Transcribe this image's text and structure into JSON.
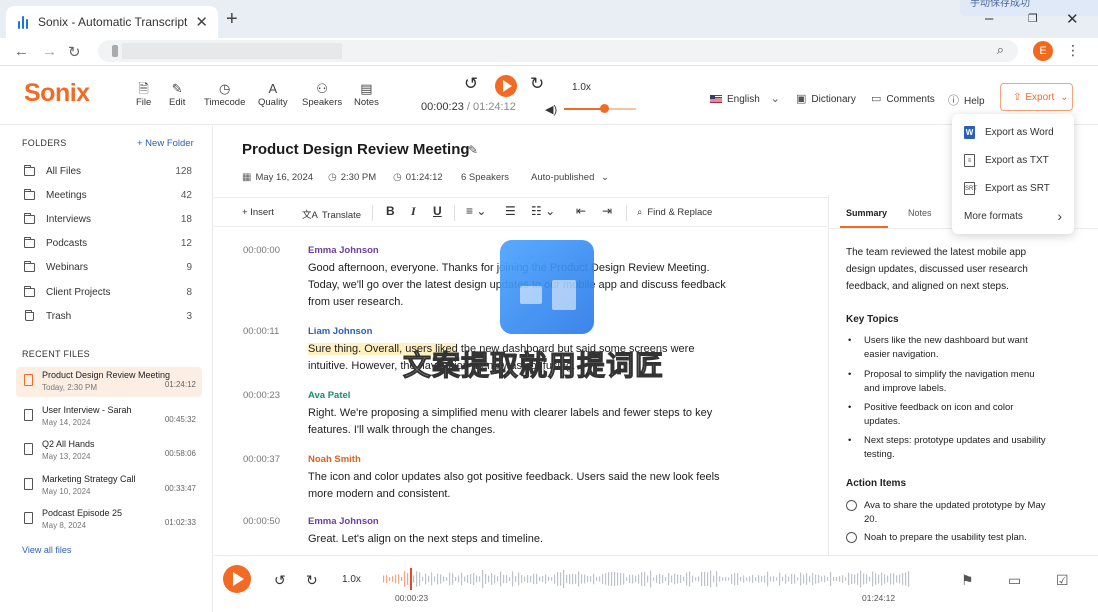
{
  "browser": {
    "tab_title": "Sonix - Automatic Transcription",
    "translate_badge": "手动保存成功",
    "new_tab": "+",
    "close": "✕"
  },
  "header": {
    "logo": "Sonix",
    "tools": [
      {
        "label": "File",
        "icon": "file-icon"
      },
      {
        "label": "Edit",
        "icon": "edit-icon"
      },
      {
        "label": "Timecode",
        "icon": "clock-icon"
      },
      {
        "label": "Quality",
        "icon": "text-quality-icon"
      },
      {
        "label": "Speakers",
        "icon": "speakers-icon"
      },
      {
        "label": "Notes",
        "icon": "notes-icon"
      }
    ],
    "player": {
      "current": "00:00:23",
      "separator": "/",
      "total": "01:24:12",
      "speed": "1.0x",
      "volume_level": 0.55
    },
    "language": "English",
    "dictionary": "Dictionary",
    "comments": "Comments",
    "help": "Help",
    "export": "Export"
  },
  "export_menu": {
    "items": [
      {
        "label": "Export as Word",
        "icon": "word-icon",
        "badge": "W"
      },
      {
        "label": "Export as TXT",
        "icon": "txt-file-icon",
        "badge": ""
      },
      {
        "label": "Export as SRT",
        "icon": "srt-file-icon",
        "badge": "SRT"
      },
      {
        "label": "More formats",
        "icon": "chevron-right-icon",
        "badge": ""
      }
    ]
  },
  "sidebar": {
    "folders_title": "FOLDERS",
    "new_folder": "+ New Folder",
    "folders": [
      {
        "label": "All Files",
        "count": "128"
      },
      {
        "label": "Meetings",
        "count": "42"
      },
      {
        "label": "Interviews",
        "count": "18"
      },
      {
        "label": "Podcasts",
        "count": "12"
      },
      {
        "label": "Webinars",
        "count": "9"
      },
      {
        "label": "Client Projects",
        "count": "8"
      },
      {
        "label": "Trash",
        "count": "3"
      }
    ],
    "recent_title": "RECENT FILES",
    "recent": [
      {
        "title": "Product Design Review Meeting",
        "date": "Today, 2:30 PM",
        "duration": "01:24:12"
      },
      {
        "title": "User Interview - Sarah",
        "date": "May 14, 2024",
        "duration": "00:45:32"
      },
      {
        "title": "Q2 All Hands",
        "date": "May 13, 2024",
        "duration": "00:58:06"
      },
      {
        "title": "Marketing Strategy Call",
        "date": "May 10, 2024",
        "duration": "00:33:47"
      },
      {
        "title": "Podcast Episode 25",
        "date": "May 8, 2024",
        "duration": "01:02:33"
      }
    ],
    "view_all": "View all files"
  },
  "document": {
    "title": "Product Design Review Meeting",
    "date": "May 16, 2024",
    "time": "2:30 PM",
    "duration": "01:24:12",
    "speakers": "6 Speakers",
    "status": "Auto-published"
  },
  "toolbar": {
    "insert": "+ Insert",
    "translate": "Translate",
    "bold": "B",
    "italic": "I",
    "underline": "U",
    "find_replace": "Find & Replace"
  },
  "transcript": [
    {
      "time": "00:00:00",
      "speaker": "Emma Johnson",
      "color": "#6b3fa0",
      "text": "Good afternoon, everyone. Thanks for joining the Product Design Review Meeting. Today, we'll go over the latest design updates to our mobile app and discuss feedback from user research."
    },
    {
      "time": "00:00:11",
      "speaker": "Liam Johnson",
      "color": "#2b5fb8",
      "text_highlight": "Sure thing. Overall, users liked",
      "text": " the new dashboard but said some screens were intuitive. However, the navigation menu was confusing."
    },
    {
      "time": "00:00:23",
      "speaker": "Ava Patel",
      "color": "#1f8a70",
      "text": "Right. We're proposing a simplified menu with clearer labels and fewer steps to key features. I'll walk through the changes."
    },
    {
      "time": "00:00:37",
      "speaker": "Noah Smith",
      "color": "#d9641e",
      "text": "The icon and color updates also got positive feedback. Users said the new look feels more modern and consistent."
    },
    {
      "time": "00:00:50",
      "speaker": "Emma Johnson",
      "color": "#6b3fa0",
      "text": "Great. Let's align on the next steps and timeline."
    }
  ],
  "right_panel": {
    "tabs": [
      "Summary",
      "Notes"
    ],
    "summary": "The team reviewed the latest mobile app design updates, discussed user research feedback, and aligned on next steps.",
    "key_topics_title": "Key Topics",
    "key_topics": [
      "Users like the new dashboard but want easier navigation.",
      "Proposal to simplify the navigation menu and improve labels.",
      "Positive feedback on icon and color updates.",
      "Next steps: prototype updates and usability testing."
    ],
    "action_items_title": "Action Items",
    "action_items": [
      "Ava to share the updated prototype by May 20.",
      "Noah to prepare the usability test plan."
    ]
  },
  "bottom_player": {
    "speed": "1.0x",
    "current": "00:00:23",
    "total": "01:24:12",
    "position": 0.0046
  },
  "overlay": {
    "watermark": "文案提取就用提词匠"
  },
  "colors": {
    "accent": "#f26b24",
    "link": "#2b5fb8"
  }
}
